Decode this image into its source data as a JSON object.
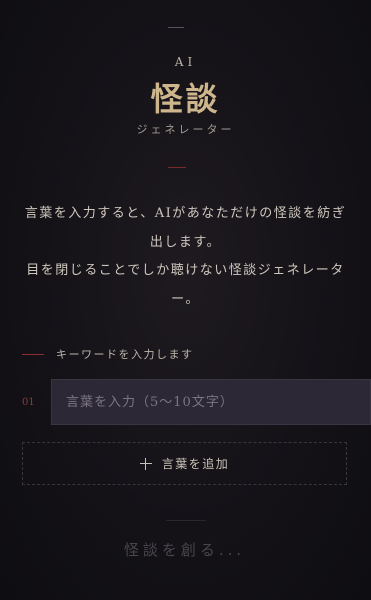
{
  "header": {
    "eyebrow": "AI",
    "title": "怪談",
    "subtitle": "ジェネレーター"
  },
  "intro": {
    "line1": "言葉を入力すると、AIがあなただけの怪談を紡ぎ出します。",
    "line2": "目を閉じることでしか聴けない怪談ジェネレーター。"
  },
  "keywords": {
    "label": "キーワードを入力します",
    "items": [
      {
        "number": "01",
        "value": "",
        "placeholder": "言葉を入力（5〜10文字）"
      }
    ],
    "add_label": "言葉を追加"
  },
  "create_button": "怪談を創る...",
  "colors": {
    "accent_gold": "#cdb58c",
    "accent_red": "#8a2f32",
    "background": "#141217"
  }
}
